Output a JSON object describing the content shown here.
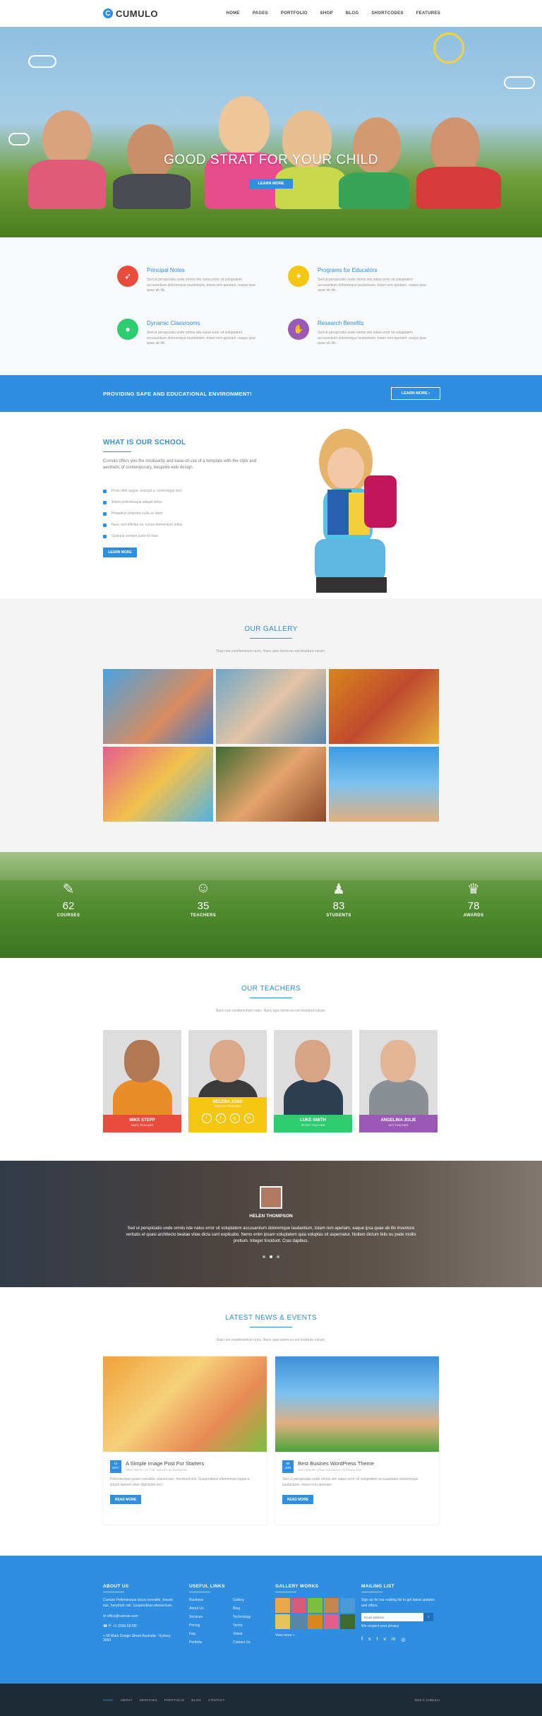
{
  "brand": {
    "logo_letter": "C",
    "name": "CUMULO",
    "accent": "#2f8ee0"
  },
  "nav": [
    "HOME",
    "PAGES",
    "PORTFOLIO",
    "SHOP",
    "BLOG",
    "SHORTCODES",
    "FEATURES"
  ],
  "hero": {
    "title": "GOOD STRAT FOR YOUR CHILD",
    "button": "LEARN MORE"
  },
  "features": [
    {
      "title": "Principal Notes",
      "icon": "rocket-icon",
      "color": "#e84c3d",
      "text": "Sed ut perspiciatis unde omnis iste natus error sit voluptatem accusantium doloremque laudantium, totam rem aperiam, eaque ipsa quae ab illo."
    },
    {
      "title": "Programs for Educators",
      "icon": "bulb-icon",
      "color": "#f3c613",
      "text": "Sed ut perspiciatis unde omnis iste natus error sit voluptatem accusantium doloremque laudantium, totam rem aperiam, eaque ipsa quae ab illo."
    },
    {
      "title": "Dynamic Classrooms",
      "icon": "pin-icon",
      "color": "#2ecc71",
      "text": "Sed ut perspiciatis unde omnis iste natus error sit voluptatem accusantium doloremque laudantium, totam rem aperiam, eaque ipsa quae ab illo."
    },
    {
      "title": "Research Benefits",
      "icon": "thumbs-up-icon",
      "color": "#9b59b6",
      "text": "Sed ut perspiciatis unde omnis iste natus error sit voluptatem accusantium doloremque laudantium, totam rem aperiam, eaque ipsa quae ab illo."
    }
  ],
  "banner": {
    "text": "PROVIDING SAFE AND EDUCATIONAL ENVIRONMENT!",
    "button": "LEARN MORE  ›"
  },
  "school": {
    "title": "WHAT IS OUR SCHOOL",
    "desc": "Cumulo offers you the modularity and ease-of-use of a template with the style and aesthetic of contemporary, bespoke web design.",
    "items": [
      "Proin nibh augue, suscipit a, scelerisque sed",
      "Etiam pellentesque aliquet tellus",
      "Phasellus pharetra nulla ac diam",
      "Nunc sed efficitur ex, luctus elementum tellus",
      "Quisque semper justo id risus"
    ],
    "button": "LEARN MORE"
  },
  "gallery": {
    "title": "OUR GALLERY",
    "sub": "Duis non condimentum nunc. Nunc quis lorem eu est tincidunt rutrum."
  },
  "stats": [
    {
      "icon": "pencil-icon",
      "value": "62",
      "label": "COURSES"
    },
    {
      "icon": "teacher-icon",
      "value": "35",
      "label": "TEACHERS"
    },
    {
      "icon": "students-icon",
      "value": "83",
      "label": "STUDENTS"
    },
    {
      "icon": "trophy-icon",
      "value": "78",
      "label": "AWARDS"
    }
  ],
  "teachers": {
    "title": "OUR TEACHERS",
    "sub": "Nunc non condimentum nunc. Nunc quis lorem eu est tincidunt rutrum.",
    "list": [
      {
        "name": "MIKE STEPP",
        "role": "MATH TEACHER",
        "color": "#e84c3d"
      },
      {
        "name": "SELENA JONS",
        "role": "ENGLISH TEACHER",
        "color": "#f3c613"
      },
      {
        "name": "LUKE SMITH",
        "role": "SPORT TEACHER",
        "color": "#2ecc71"
      },
      {
        "name": "ANGELINA JOLIE",
        "role": "ART TEACHER",
        "color": "#9b59b6"
      }
    ]
  },
  "testimonial": {
    "name": "HELEN THOMPSON",
    "quote": "Sed ut perspiciatis unde omnis iste natus error sit voluptatem accusantium doloremque laudantium, totam rem aperiam, eaque ipsa quae ab illo inventore veritatis et quasi architecto beatae vitae dicta sunt explicabo. Nemo enim ipsam voluptatem quia voluptas sit aspernatur. Nullam dictum felis eu pede mollis pretium. Integer tincidunt. Cras dapibus."
  },
  "news": {
    "title": "LATEST NEWS & EVENTS",
    "sub": "Duis non condimentum nunc. Nunc quis lorem eu est tincidunt rutrum.",
    "posts": [
      {
        "day": "12",
        "mon": "MAY",
        "title": "A Simple Image Post For Starters",
        "by": "WRITTEN BY: VICTOR   TAGGED IN: BUSINESS",
        "text": "Pellentesque quam convallis, mauris nec, hendrerit nisl. Suspendisse elementum turpis a ipsum laoreet vitae dignissim orci.",
        "button": "READ MORE"
      },
      {
        "day": "08",
        "mon": "JUN",
        "title": "Best Busines WordPress Theme",
        "by": "WRITTEN BY: JOHN   TAGGED IN: TECHNOLOGY",
        "text": "Sed ut perspiciatis unde omnis iste natus error sit voluptatem accusantium doloremque laudantium, totam rem aperiam.",
        "button": "READ MORE"
      }
    ]
  },
  "footer": {
    "about_title": "ABOUT US",
    "about_text": "Cumulo Pellentesque lacus convallis, mauris nec, hendrerit nisl. Suspendisse elementum.",
    "email": "office@cumulo.com",
    "phone": "P: +1 (234) 56789",
    "address": "56 Mark Design Street Australia - Sydney 3000",
    "links_title": "USEFUL LINKS",
    "links": [
      "Business",
      "Gallery",
      "About Us",
      "Blog",
      "Services",
      "Technology",
      "Pricing",
      "Terms",
      "Faq",
      "Vision",
      "Portfolio",
      "Contact Us"
    ],
    "gallery_title": "GALLERY WORKS",
    "view_more": "View more »",
    "mail_title": "MAILING LIST",
    "mail_text": "Sign up for our mailing list to get latest updates and offers.",
    "mail_placeholder": "Email address",
    "privacy": "We respect your privacy",
    "bottom_nav": [
      "HOME",
      "ABOUT",
      "SERVICES",
      "PORTFOLIO",
      "BLOG",
      "CONTACT"
    ],
    "copyright": "2015 © CUMULO."
  }
}
